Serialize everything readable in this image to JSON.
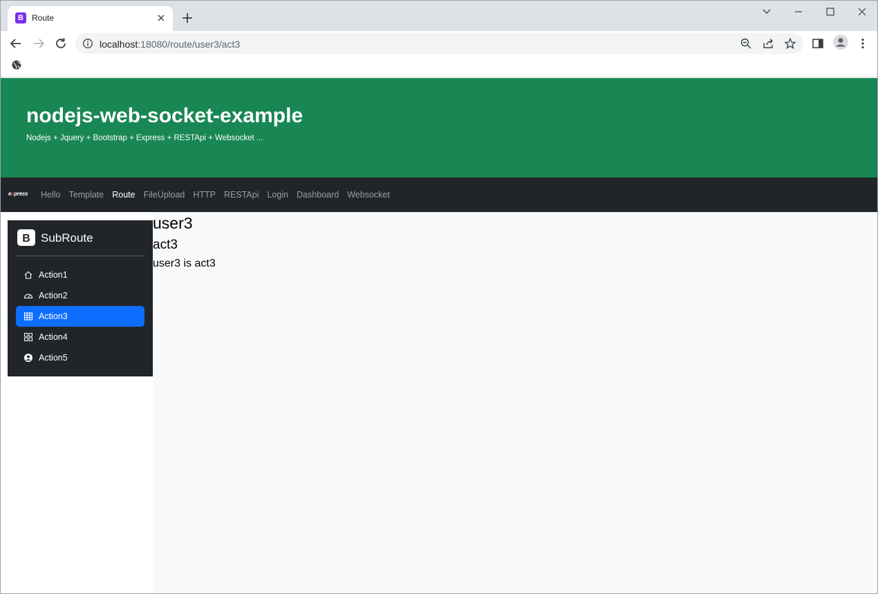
{
  "browser": {
    "tab_title": "Route",
    "tab_favicon_letter": "B",
    "url_host": "localhost",
    "url_rest": ":18080/route/user3/act3"
  },
  "hero": {
    "title": "nodejs-web-socket-example",
    "subtitle": "Nodejs + Jquery + Bootstrap + Express + RESTApi + Websocket ..."
  },
  "navbar": {
    "brand_prefix": "e",
    "brand_highlight": "x",
    "brand_suffix": "press",
    "links": [
      "Hello",
      "Template",
      "Route",
      "FileUpload",
      "HTTP",
      "RESTApi",
      "Login",
      "Dashboard",
      "Websocket"
    ],
    "active_link": "Route"
  },
  "sidebar": {
    "logo_letter": "B",
    "title": "SubRoute",
    "items": [
      {
        "label": "Action1",
        "icon": "house-icon"
      },
      {
        "label": "Action2",
        "icon": "speedometer-icon"
      },
      {
        "label": "Action3",
        "icon": "table-icon"
      },
      {
        "label": "Action4",
        "icon": "grid-icon"
      },
      {
        "label": "Action5",
        "icon": "person-circle-icon"
      }
    ],
    "active_item": "Action3"
  },
  "main": {
    "user": "user3",
    "action": "act3",
    "message": "user3 is act3"
  },
  "colors": {
    "hero_bg": "#198754",
    "navbar_bg": "#212529",
    "active_item_bg": "#0d6efd",
    "content_bg": "#f8f9fa"
  }
}
